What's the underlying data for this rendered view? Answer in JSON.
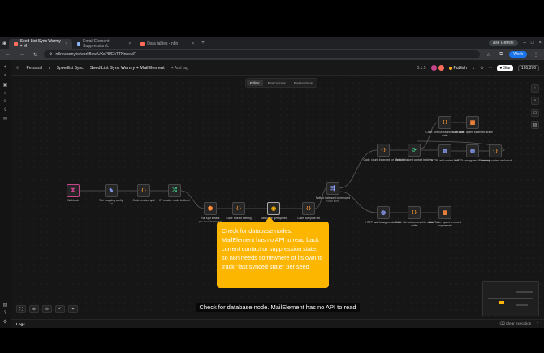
{
  "browser": {
    "tabs": [
      {
        "label": "Seed List Sync Warmy + M",
        "active": true
      },
      {
        "label": "Email Element - Suppression L"
      },
      {
        "label": "Data tables - n8n"
      }
    ],
    "new_tab": "+",
    "ask_gemini": "Ask Gemini",
    "url": "n8n.warmy.io/workflow/UXsP8/EkTTNnneAF",
    "work_label": "Work"
  },
  "header": {
    "breadcrumb_personal": "Personal",
    "breadcrumb_sep": "/",
    "breadcrumb_project": "Speedlist Sync",
    "workflow_name": "Seed List Sync Warmy + MailElement",
    "add_tag": "+ Add tag",
    "version": "0.1.5",
    "publish": "Publish",
    "star": "Star",
    "star_count": "165,376"
  },
  "view_tabs": [
    "Editor",
    "Executions",
    "Evaluations"
  ],
  "nodes": {
    "webhook": {
      "label": "Webhook",
      "icon": "⧗"
    },
    "set_mapping": {
      "label": "Set: mapping config",
      "sub": "set",
      "icon": "✎"
    },
    "code_resolve": {
      "label": "Code: resolve split",
      "icon": "{ }"
    },
    "if_route": {
      "label": "IF: resolve mode to direct",
      "icon": "⤮"
    },
    "flat_split": {
      "label": "Flat split emails",
      "sub": "per-recorder emails",
      "icon": "⬢"
    },
    "code_extract": {
      "label": "Code: extract filtering",
      "icon": "{ }"
    },
    "datatable_get": {
      "label": "DataTable: get synced",
      "icon": "◉"
    },
    "code_compute": {
      "label": "Code: compute diff",
      "icon": "{ }"
    },
    "switch_balanced": {
      "label": "Switch: balanced to removed",
      "sub": "route lines",
      "icon": "⇶"
    },
    "code_chunk": {
      "label": "Code: chunk balanced for contact",
      "icon": "{ }"
    },
    "split_batches": {
      "label": "Split: balanced contact batches",
      "icon": "⟳"
    },
    "http_add": {
      "label": "HTTP: add contact bulk",
      "icon": "◍"
    },
    "http_unsuppress": {
      "label": "HTTP: unsuppress balanced",
      "icon": "◍"
    },
    "code_log": {
      "label": "Code: log contact add result",
      "icon": "{ }"
    },
    "code_set_balanced": {
      "label": "Code: Set out balanced for state write",
      "icon": "{ }"
    },
    "dt_upsert_active": {
      "label": "DataTable: upsert balanced active",
      "icon": "▦"
    },
    "http_suppression": {
      "label": "HTTP: add to suppression list",
      "icon": "◍"
    },
    "code_set_removed": {
      "label": "Code: Set out removed for state write",
      "icon": "{ }"
    },
    "dt_upsert_removed": {
      "label": "DataTable: upsert removed suppressed",
      "icon": "▦"
    }
  },
  "callout": "Check for database nodes. MailElement has no API to read back current contact or suppression state, so n8n needs somewhere of its own to track \"last synced state\" per seed",
  "caption": "Check for database node. MailElement has no API to read",
  "logs": {
    "label": "Logs",
    "clear": "Clear execution"
  },
  "colors": {
    "accent": "#ff6d5a",
    "callout": "#fdb600",
    "code_node": "#ff9b2f",
    "http_node": "#8fa4ff",
    "datatable_node": "#ff8a3d",
    "webhook_node": "#c5448a"
  }
}
